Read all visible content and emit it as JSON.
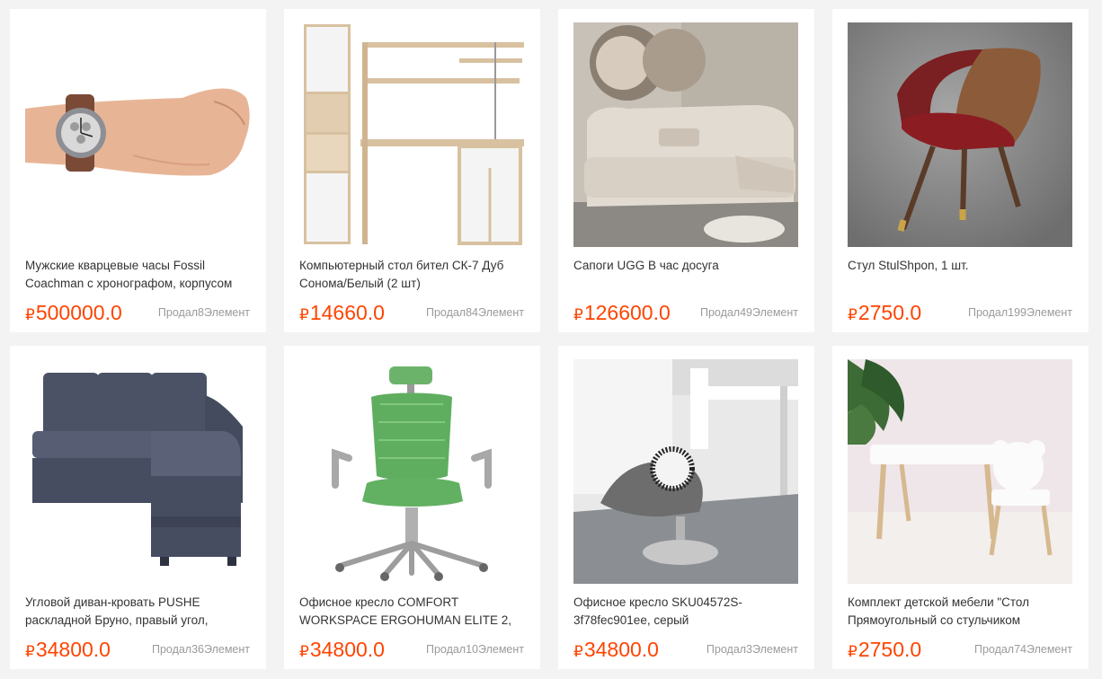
{
  "products": [
    {
      "title": "Мужские кварцевые часы Fossil Coachman с хронографом, корпусом",
      "currency": "₽",
      "price": "500000.0",
      "sold": "Продал8Элемент",
      "image": "wristwatch"
    },
    {
      "title": "Компьютерный стол бител СК-7 Дуб Сонома/Белый  (2 шт)",
      "currency": "₽",
      "price": "14660.0",
      "sold": "Продал84Элемент",
      "image": "computer-desk"
    },
    {
      "title": "Сапоги UGG В час досуга",
      "currency": "₽",
      "price": "126600.0",
      "sold": "Продал49Элемент",
      "image": "recliner-sofa"
    },
    {
      "title": "Стул StulShpon, 1 шт.",
      "currency": "₽",
      "price": "2750.0",
      "sold": "Продал199Элемент",
      "image": "armchair"
    },
    {
      "title": "Угловой диван-кровать PUSHE раскладной Бруно, правый угол,",
      "currency": "₽",
      "price": "34800.0",
      "sold": "Продал36Элемент",
      "image": "corner-sofa"
    },
    {
      "title": "Офисное кресло COMFORT WORKSPACE ERGOHUMAN ELITE 2,",
      "currency": "₽",
      "price": "34800.0",
      "sold": "Продал10Элемент",
      "image": "office-chair-green"
    },
    {
      "title": "Офисное кресло SKU04572S-3f78fec901ee, серый",
      "currency": "₽",
      "price": "34800.0",
      "sold": "Продал3Элемент",
      "image": "swivel-chair-gray"
    },
    {
      "title": "Комплект детской мебели \"Стол Прямоугольный со стульчиком",
      "currency": "₽",
      "price": "2750.0",
      "sold": "Продал74Элемент",
      "image": "kids-furniture-set"
    }
  ],
  "colors": {
    "price": "#ff4400",
    "title": "#333333",
    "sold": "#9a9a9a",
    "background": "#f3f3f3"
  }
}
